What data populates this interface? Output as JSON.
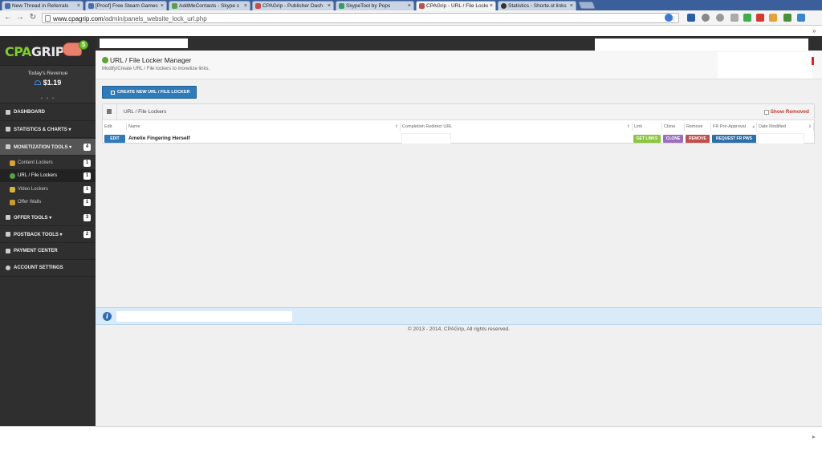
{
  "browser": {
    "tabs": [
      {
        "title": "New Thread in Referrals",
        "color": "#4a6fa8"
      },
      {
        "title": "[Proof] Free Steam Games",
        "color": "#4a6fa8"
      },
      {
        "title": "AddMeContacts - Skype c",
        "color": "#5aa04a"
      },
      {
        "title": "CPAGrip - Publisher Dash",
        "color": "#c0504d"
      },
      {
        "title": "SkypeTool by Pops",
        "color": "#3a9a6a"
      },
      {
        "title": "CPAGrip - URL / File Locke",
        "color": "#c0504d",
        "active": true
      },
      {
        "title": "Statistics - Shorte.st links",
        "color": "#333333"
      }
    ],
    "url_domain": "www.cpagrip.com",
    "url_path": "/admin/panels_website_lock_url.php",
    "menu_glyph": "»"
  },
  "sidebar": {
    "revenue_label": "Today's Revenue",
    "revenue_value": "$1.19",
    "dots": "• • •",
    "nav": [
      {
        "label": "DASHBOARD",
        "name": "nav-dashboard"
      },
      {
        "label": "STATISTICS & CHARTS ▾",
        "name": "nav-statistics-charts"
      },
      {
        "label": "MONETIZATION TOOLS ▾",
        "name": "nav-monetization-tools",
        "badge": "4",
        "active": true
      },
      {
        "label": "OFFER TOOLS ▾",
        "name": "nav-offer-tools",
        "badge": "3"
      },
      {
        "label": "POSTBACK TOOLS ▾",
        "name": "nav-postback-tools",
        "badge": "2"
      },
      {
        "label": "PAYMENT CENTER",
        "name": "nav-payment-center"
      },
      {
        "label": "ACCOUNT SETTINGS",
        "name": "nav-account-settings"
      }
    ],
    "subnav": [
      {
        "label": "Content Lockers",
        "badge": "1",
        "color": "#e0a030"
      },
      {
        "label": "URL / File Lockers",
        "badge": "1",
        "color": "#5aa04a",
        "active": true
      },
      {
        "label": "Video Lockers",
        "badge": "1",
        "color": "#d9b43a"
      },
      {
        "label": "Offer Walls",
        "badge": "1",
        "color": "#c99a2e"
      }
    ]
  },
  "header": {
    "title": "URL / File Locker Manager",
    "subtitle": "Modify/Create URL / File lockers to monetize links."
  },
  "create_button": "CREATE NEW URL / FILE LOCKER",
  "panel": {
    "title": "URL / File Lockers",
    "show_removed": "Show Removed",
    "columns": [
      "Edit",
      "Name",
      "Completion Redirect URL",
      "Link",
      "Clone",
      "Remove",
      "FR Pre-Approval",
      "Date Modified"
    ],
    "sort_glyph": "⇕",
    "rows": [
      {
        "edit": "EDIT",
        "name": "Amelie Fingering Herself",
        "link": "GET LINKS",
        "clone": "CLONE",
        "remove": "REMOVE",
        "fr": "REQUEST FR PWS"
      }
    ]
  },
  "info_icon": "i",
  "footer": "© 2013 - 2014, CPAGrip, All rights reserved.",
  "colors": {
    "sidebar_bg": "#2f2f2f",
    "primary_button": "#2f7ab8",
    "get_links": "#8cc63f",
    "clone": "#9b6fc0",
    "remove": "#c0504d",
    "request_fr": "#2f6fa8"
  }
}
